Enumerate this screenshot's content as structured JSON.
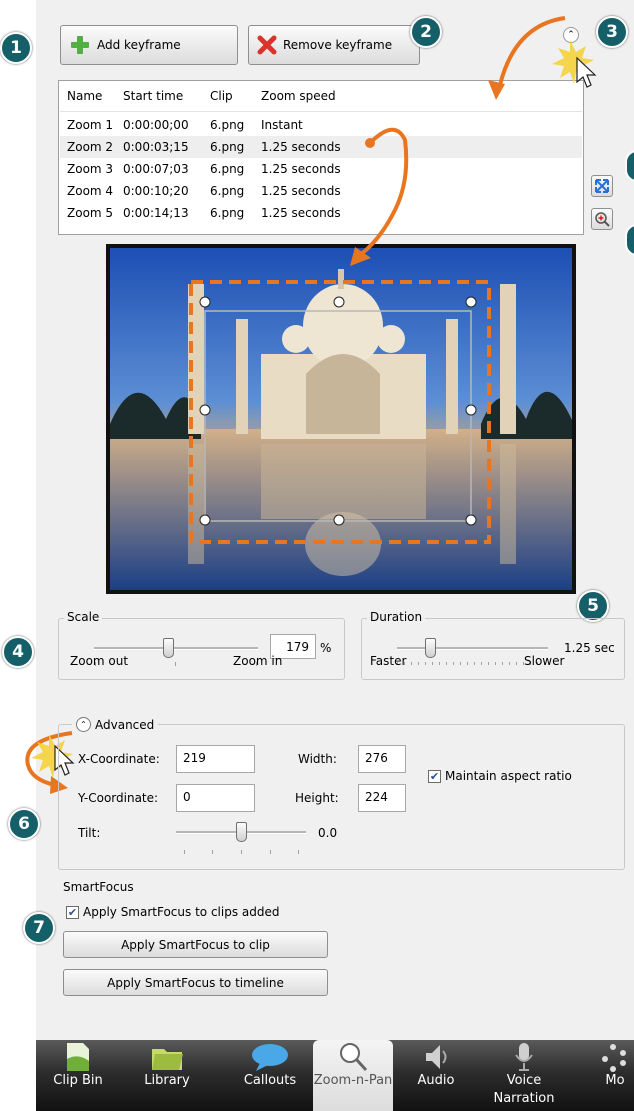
{
  "toolbar": {
    "add_keyframe": "Add keyframe",
    "remove_keyframe": "Remove keyframe"
  },
  "keyframes": {
    "columns": [
      "Name",
      "Start time",
      "Clip",
      "Zoom speed"
    ],
    "rows": [
      {
        "name": "Zoom 1",
        "start": "0:00:00;00",
        "clip": "6.png",
        "speed": "Instant"
      },
      {
        "name": "Zoom 2",
        "start": "0:00:03;15",
        "clip": "6.png",
        "speed": "1.25 seconds"
      },
      {
        "name": "Zoom 3",
        "start": "0:00:07;03",
        "clip": "6.png",
        "speed": "1.25 seconds"
      },
      {
        "name": "Zoom 4",
        "start": "0:00:10;20",
        "clip": "6.png",
        "speed": "1.25 seconds"
      },
      {
        "name": "Zoom 5",
        "start": "0:00:14;13",
        "clip": "6.png",
        "speed": "1.25 seconds"
      }
    ],
    "selected_index": 1
  },
  "callouts": [
    "1",
    "2",
    "3",
    "4",
    "5",
    "6",
    "7"
  ],
  "scale": {
    "title": "Scale",
    "value": "179",
    "unit": "%",
    "min_label": "Zoom out",
    "max_label": "Zoom in",
    "slider_fraction": 0.45
  },
  "duration": {
    "title": "Duration",
    "value": "1.25 sec",
    "min_label": "Faster",
    "max_label": "Slower",
    "slider_fraction": 0.22
  },
  "advanced": {
    "title": "Advanced",
    "x_label": "X-Coordinate:",
    "x_value": "219",
    "y_label": "Y-Coordinate:",
    "y_value": "0",
    "width_label": "Width:",
    "width_value": "276",
    "height_label": "Height:",
    "height_value": "224",
    "aspect_label": "Maintain aspect ratio",
    "aspect_checked": true,
    "tilt_label": "Tilt:",
    "tilt_value": "0.0",
    "tilt_fraction": 0.5
  },
  "smartfocus": {
    "title": "SmartFocus",
    "apply_clips_label": "Apply SmartFocus to clips added",
    "apply_clips_checked": true,
    "apply_clip_button": "Apply SmartFocus to clip",
    "apply_timeline_button": "Apply SmartFocus to timeline"
  },
  "tabs": [
    {
      "label": "Clip Bin",
      "icon": "clip-bin-icon"
    },
    {
      "label": "Library",
      "icon": "library-folder-icon"
    },
    {
      "label": "Callouts",
      "icon": "speech-bubble-icon"
    },
    {
      "label": "Zoom-n-Pan",
      "icon": "magnifier-icon",
      "active": true
    },
    {
      "label": "Audio",
      "icon": "speaker-icon"
    },
    {
      "label": "Voice Narration",
      "icon": "microphone-icon"
    },
    {
      "label": "Mo",
      "icon": "more-icon"
    }
  ],
  "colors": {
    "accent_orange": "#e8751f",
    "callout_teal": "#155f69",
    "selected_row": "#eeeeee"
  }
}
